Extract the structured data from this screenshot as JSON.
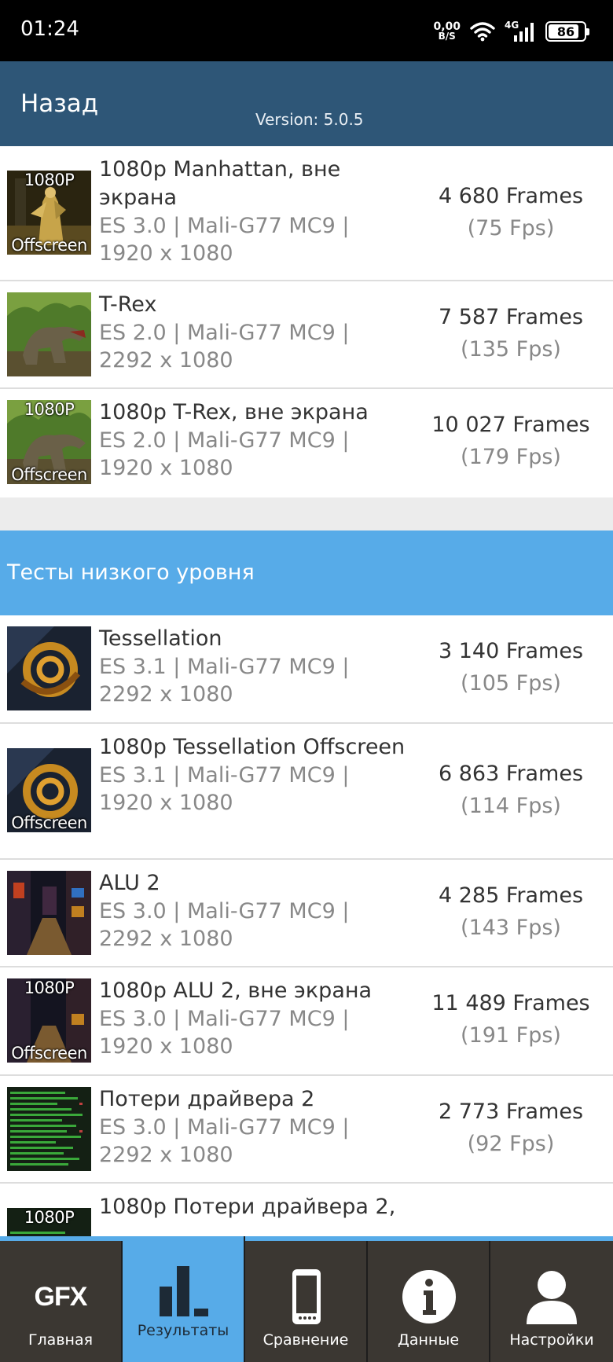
{
  "status_bar": {
    "time": "01:24",
    "net_speed_value": "0,00",
    "net_speed_unit": "B/S",
    "network": "4G",
    "battery": "86",
    "battery_level": 0.86
  },
  "header": {
    "back_label": "Назад",
    "version": "Version: 5.0.5"
  },
  "section_low_level": "Тесты низкого уровня",
  "badges": {
    "p1080": "1080P",
    "offscreen": "Offscreen"
  },
  "results": [
    {
      "title": "1080p Manhattan, вне экрана",
      "api": "ES 3.0 | Mali-G77 MC9 |",
      "resolution": "1920 x 1080",
      "frames": "4 680 Frames",
      "fps": "(75 Fps)"
    },
    {
      "title": "T-Rex",
      "api": "ES 2.0 | Mali-G77 MC9 |",
      "resolution": "2292 x 1080",
      "frames": "7 587 Frames",
      "fps": "(135 Fps)"
    },
    {
      "title": "1080p T-Rex, вне экрана",
      "api": "ES 2.0 | Mali-G77 MC9 |",
      "resolution": "1920 x 1080",
      "frames": "10 027 Frames",
      "fps": "(179 Fps)"
    }
  ],
  "low_level": [
    {
      "title": "Tessellation",
      "api": "ES 3.1 | Mali-G77 MC9 |",
      "resolution": "2292 x 1080",
      "frames": "3 140 Frames",
      "fps": "(105 Fps)"
    },
    {
      "title": "1080p Tessellation Offscreen",
      "api": "ES 3.1 | Mali-G77 MC9 |",
      "resolution": "1920 x 1080",
      "frames": "6 863 Frames",
      "fps": "(114 Fps)"
    },
    {
      "title": "ALU 2",
      "api": "ES 3.0 | Mali-G77 MC9 |",
      "resolution": "2292 x 1080",
      "frames": "4 285 Frames",
      "fps": "(143 Fps)"
    },
    {
      "title": "1080p ALU 2, вне экрана",
      "api": "ES 3.0 | Mali-G77 MC9 |",
      "resolution": "1920 x 1080",
      "frames": "11 489 Frames",
      "fps": "(191 Fps)"
    },
    {
      "title": "Потери драйвера 2",
      "api": "ES 3.0 | Mali-G77 MC9 |",
      "resolution": "2292 x 1080",
      "frames": "2 773 Frames",
      "fps": "(92 Fps)"
    },
    {
      "title": "1080p Потери драйвера 2,"
    }
  ],
  "nav": {
    "home_logo": "GFX",
    "home": "Главная",
    "results": "Результаты",
    "compare": "Сравнение",
    "data": "Данные",
    "settings": "Настройки",
    "active": "results"
  },
  "colors": {
    "header_bg": "#2e5677",
    "section_bg": "#57abe8",
    "nav_bg": "#3b3732",
    "nav_active": "#57abe8"
  }
}
